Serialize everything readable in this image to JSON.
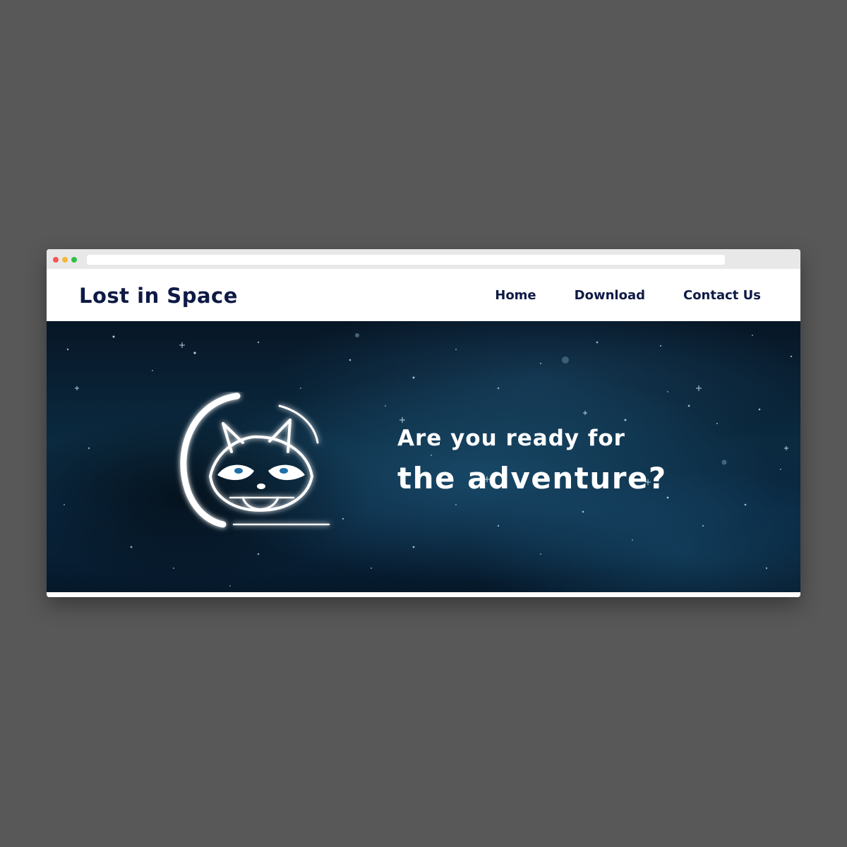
{
  "site": {
    "logo": "Lost in Space"
  },
  "nav": {
    "items": [
      {
        "label": "Home"
      },
      {
        "label": "Download"
      },
      {
        "label": "Contact Us"
      }
    ]
  },
  "hero": {
    "line1": "Are you ready for",
    "line2": "the adventure?",
    "mascot_icon": "raccoon-astronaut-icon"
  },
  "colors": {
    "brand": "#0e1a45",
    "hero_bg": "#0b2a40",
    "glow": "#7ecbff",
    "page_bg": "#585858"
  }
}
